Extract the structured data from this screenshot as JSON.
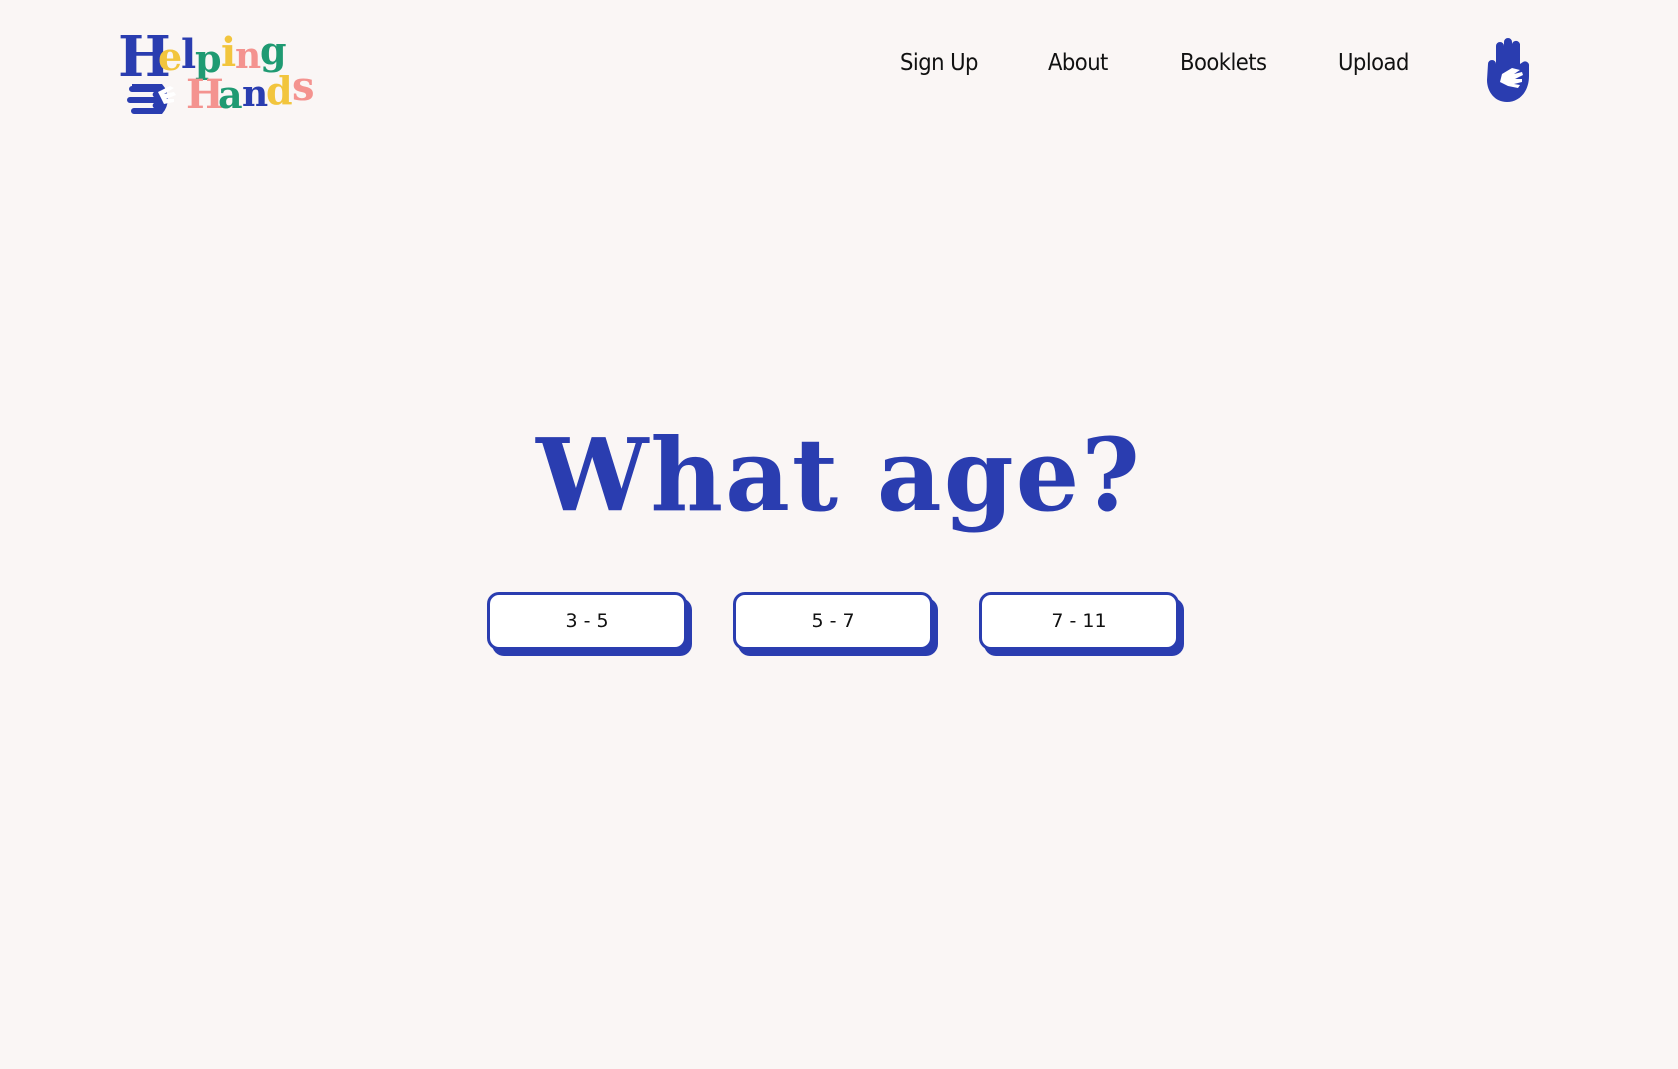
{
  "brand": {
    "name_line1": "Helping",
    "name_line2": "Hands",
    "logo_icon": "helping-hands-logo",
    "colors": {
      "blue": "#2a3db0",
      "yellow": "#f2c53d",
      "green": "#1f9a72",
      "pink": "#f4938f"
    }
  },
  "nav": {
    "items": [
      {
        "label": "Sign Up"
      },
      {
        "label": "About"
      },
      {
        "label": "Booklets"
      },
      {
        "label": "Upload"
      }
    ],
    "profile_icon": "hand-icon"
  },
  "main": {
    "heading": "What age?",
    "age_options": [
      {
        "label": "3 - 5"
      },
      {
        "label": "5 - 7"
      },
      {
        "label": "7 - 11"
      }
    ]
  },
  "theme": {
    "background": "#faf6f5",
    "accent": "#2a3db0",
    "button_bg": "#ffffff"
  }
}
